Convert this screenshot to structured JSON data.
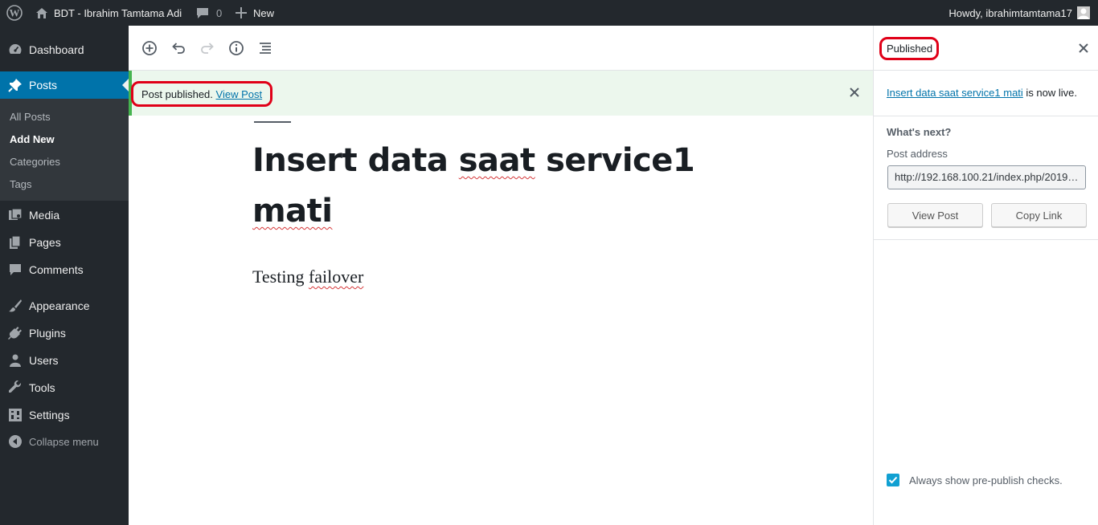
{
  "admin_bar": {
    "site_name": "BDT - Ibrahim Tamtama Adi",
    "comments_count": "0",
    "new_label": "New",
    "greeting": "Howdy, ibrahimtamtama17"
  },
  "sidebar": {
    "items": [
      {
        "label": "Dashboard",
        "icon": "dashboard-icon"
      },
      {
        "label": "Posts",
        "icon": "pin-icon"
      },
      {
        "label": "Media",
        "icon": "media-icon"
      },
      {
        "label": "Pages",
        "icon": "pages-icon"
      },
      {
        "label": "Comments",
        "icon": "comments-icon"
      },
      {
        "label": "Appearance",
        "icon": "paintbrush-icon"
      },
      {
        "label": "Plugins",
        "icon": "plugin-icon"
      },
      {
        "label": "Users",
        "icon": "users-icon"
      },
      {
        "label": "Tools",
        "icon": "wrench-icon"
      },
      {
        "label": "Settings",
        "icon": "settings-icon"
      },
      {
        "label": "Collapse menu",
        "icon": "collapse-icon"
      }
    ],
    "submenu": [
      "All Posts",
      "Add New",
      "Categories",
      "Tags"
    ]
  },
  "notice": {
    "text": "Post published.",
    "link": "View Post"
  },
  "post": {
    "title_word1": "Insert data ",
    "title_word2": "saat",
    "title_word3": " service1",
    "title_word4": "mati",
    "content_word1": "Testing ",
    "content_word2": "failover"
  },
  "panel": {
    "status": "Published",
    "live_link": "Insert data saat service1 mati",
    "live_suffix": " is now live.",
    "whats_next": "What's next?",
    "post_address_label": "Post address",
    "post_address": "http://192.168.100.21/index.php/2019/...",
    "view_post": "View Post",
    "copy_link": "Copy Link",
    "checkbox_label": "Always show pre-publish checks."
  },
  "colors": {
    "admin_bg": "#23282d",
    "accent": "#0073aa",
    "success": "#46b450",
    "highlight": "#e00018"
  }
}
